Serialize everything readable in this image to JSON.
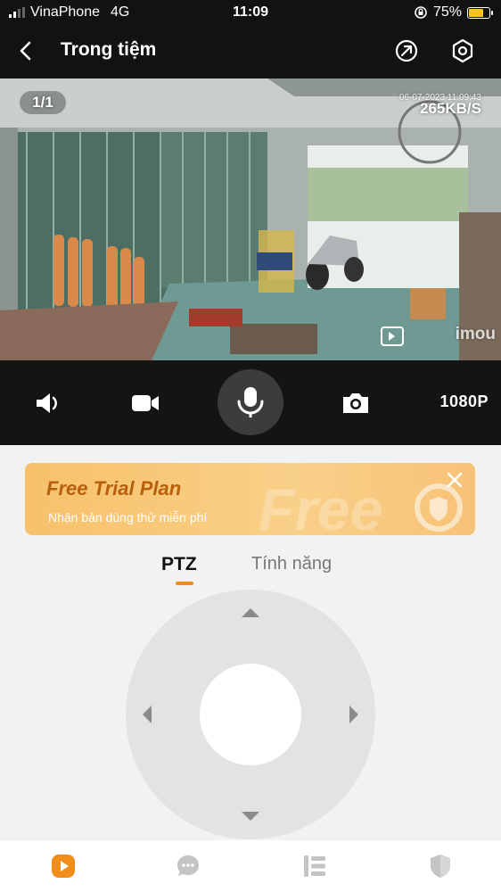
{
  "status_bar": {
    "carrier": "VinaPhone",
    "network": "4G",
    "time": "11:09",
    "battery": "75%",
    "battery_level": 0.75
  },
  "header": {
    "title": "Trong tiệm",
    "icons": [
      "back-icon",
      "share-icon",
      "settings-icon"
    ]
  },
  "video": {
    "pager": "1/1",
    "timestamp": "06-07-2023 11:09:43",
    "speed": "265KB/S",
    "watermark": "imou"
  },
  "controls": {
    "icons": [
      "speaker-icon",
      "record-icon",
      "microphone-icon",
      "camera-icon"
    ],
    "resolution": "1080P"
  },
  "banner": {
    "title": "Free Trial Plan",
    "subtitle": "Nhận bản dùng thử miễn phí",
    "watermark": "Free"
  },
  "tabs": [
    {
      "label": "PTZ",
      "active": true
    },
    {
      "label": "Tính năng",
      "active": false
    }
  ],
  "bottom_nav": {
    "icons": [
      "play-icon",
      "message-icon",
      "list-icon",
      "shield-icon"
    ],
    "active": 0
  },
  "colors": {
    "accent": "#f08d1b",
    "top_bg": "#121212",
    "banner_title": "#b85f0c"
  }
}
